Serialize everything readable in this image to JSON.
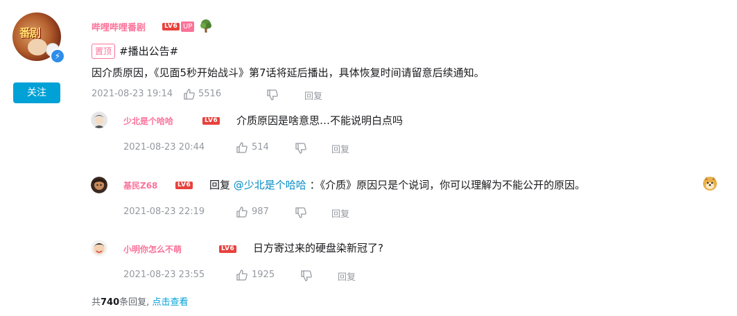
{
  "main_comment": {
    "avatar_text": "番剧",
    "username": "哔哩哔哩番剧",
    "level": "LV6",
    "up_label": "UP",
    "follow_label": "关注",
    "pin_label": "置顶",
    "hashtag": "#播出公告#",
    "content": "因介质原因，《见面5秒开始战斗》第7话将延后播出，具体恢复时间请留意后续通知。",
    "time": "2021-08-23 19:14",
    "likes": "5516",
    "reply_label": "回复"
  },
  "replies": [
    {
      "username": "少北是个哈哈",
      "level": "LV6",
      "text": "介质原因是啥意思…不能说明白点吗",
      "time": "2021-08-23 20:44",
      "likes": "514",
      "reply_label": "回复"
    },
    {
      "username": "基民Z68",
      "level": "LV6",
      "reply_prefix": "回复",
      "mention": "@少北是个哈哈",
      "text": "：《介质》原因只是个说词，你可以理解为不能公开的原因。",
      "time": "2021-08-23 22:19",
      "likes": "987",
      "reply_label": "回复"
    },
    {
      "username": "小明你怎么不萌",
      "level": "LV6",
      "text": "日方寄过来的硬盘染新冠了?",
      "time": "2021-08-23 23:55",
      "likes": "1925",
      "reply_label": "回复"
    }
  ],
  "footer": {
    "prefix": "共",
    "count": "740",
    "suffix": "条回复,",
    "view_label": "点击查看"
  },
  "colors": {
    "username_pink": "#fb7299",
    "level_red": "#e8413d",
    "follow_blue": "#00a1d6",
    "mention_blue": "#008ac5",
    "meta_gray": "#9499a0"
  },
  "icons": [
    "verified-icon",
    "tree-medal-icon",
    "like-icon",
    "dislike-icon",
    "doge-emoji-icon"
  ]
}
